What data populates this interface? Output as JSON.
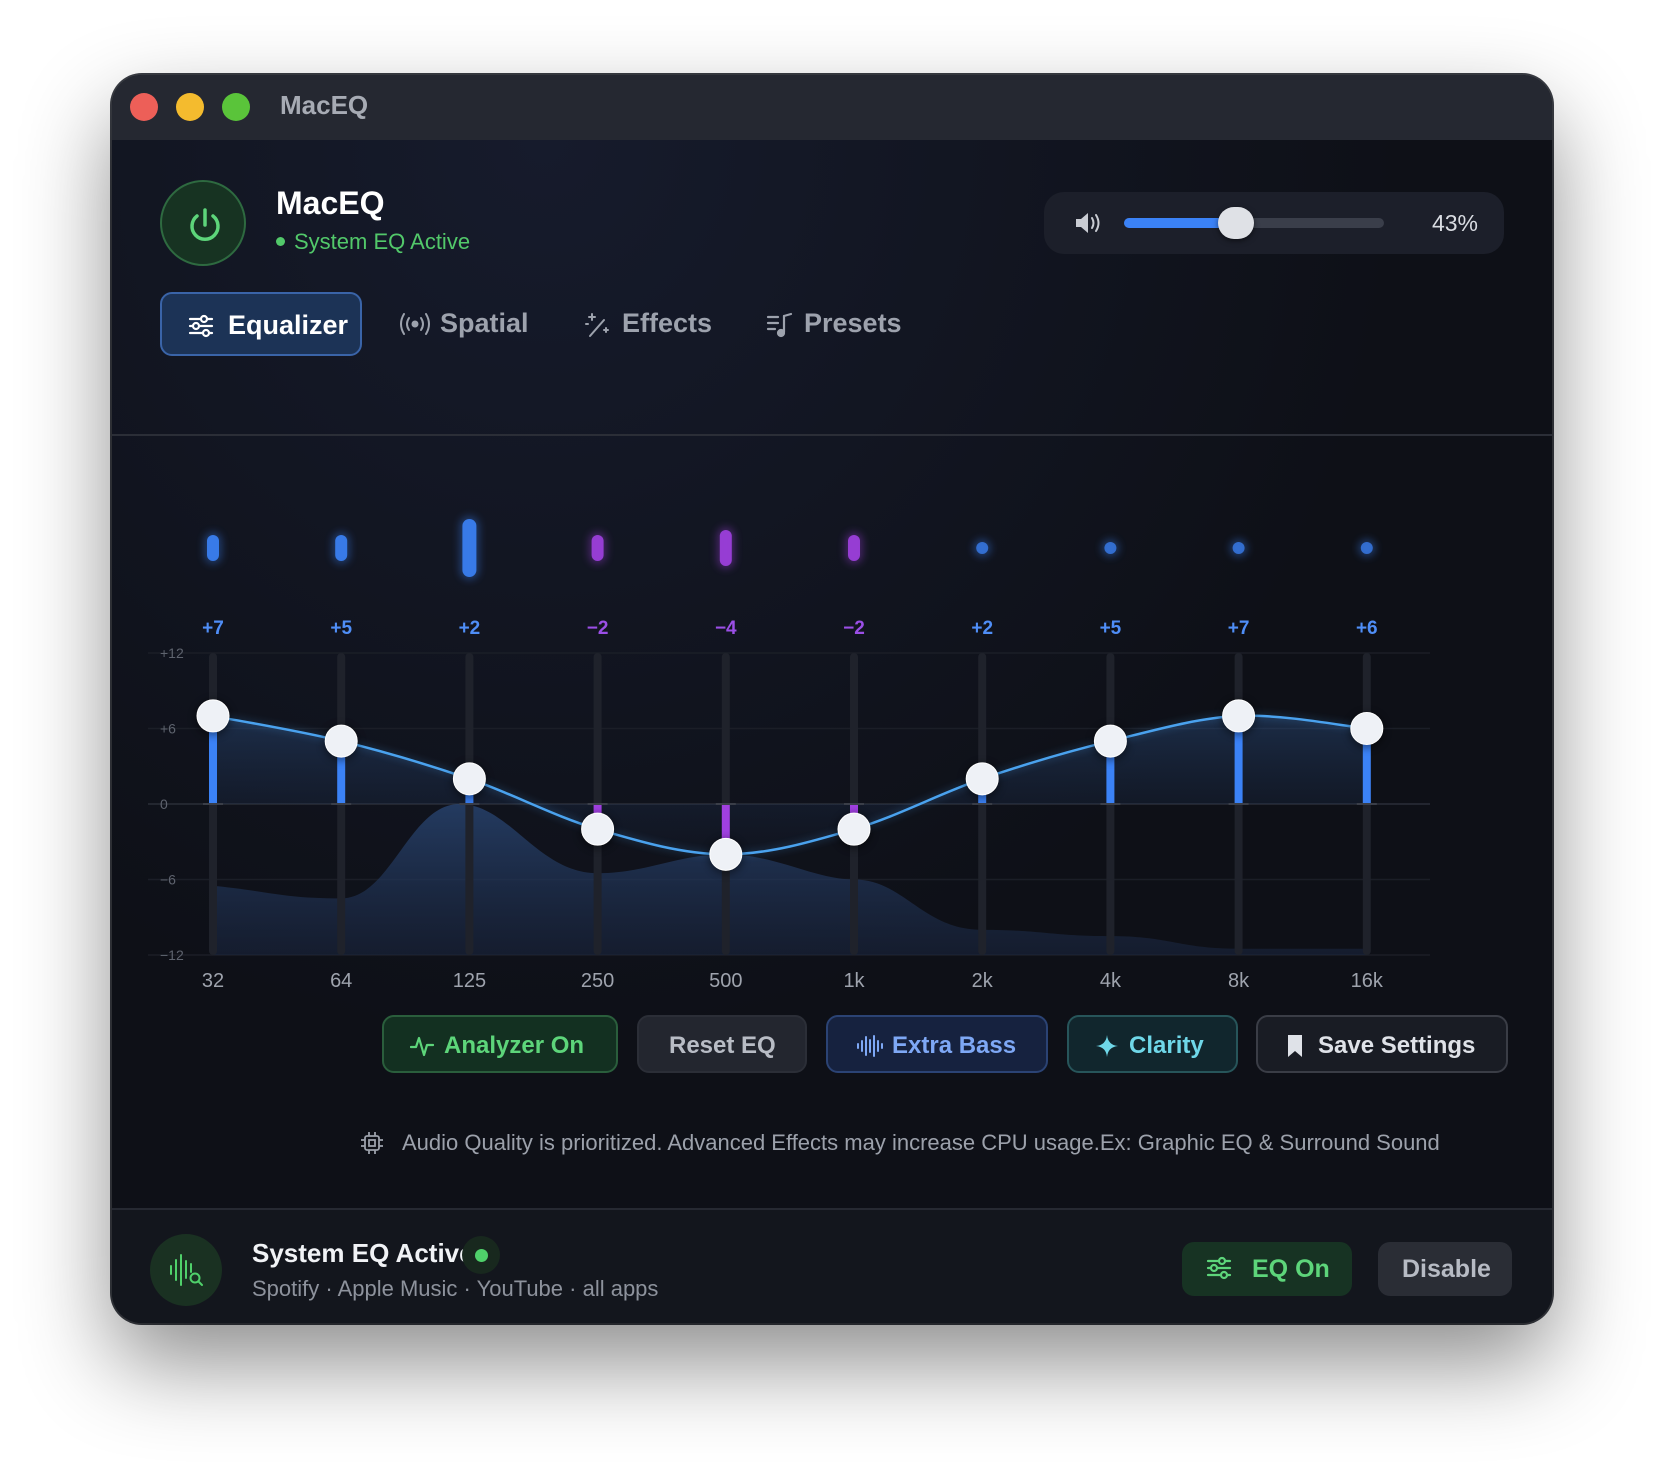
{
  "window": {
    "title": "MacEQ"
  },
  "header": {
    "app_name": "MacEQ",
    "status": "System EQ Active",
    "volume": {
      "value": 0.43,
      "label": "43%"
    }
  },
  "tabs": [
    {
      "label": "Equalizer",
      "active": true,
      "icon": "sliders-icon"
    },
    {
      "label": "Spatial",
      "active": false,
      "icon": "broadcast-icon"
    },
    {
      "label": "Effects",
      "active": false,
      "icon": "magic-wand-icon"
    },
    {
      "label": "Presets",
      "active": false,
      "icon": "music-list-icon"
    }
  ],
  "equalizer": {
    "bands": [
      {
        "freq": "32",
        "gain": 7,
        "label": "+7"
      },
      {
        "freq": "64",
        "gain": 5,
        "label": "+5"
      },
      {
        "freq": "125",
        "gain": 2,
        "label": "+2"
      },
      {
        "freq": "250",
        "gain": -2,
        "label": "−2"
      },
      {
        "freq": "500",
        "gain": -4,
        "label": "−4"
      },
      {
        "freq": "1k",
        "gain": -2,
        "label": "−2"
      },
      {
        "freq": "2k",
        "gain": 2,
        "label": "+2"
      },
      {
        "freq": "4k",
        "gain": 5,
        "label": "+5"
      },
      {
        "freq": "8k",
        "gain": 7,
        "label": "+7"
      },
      {
        "freq": "16k",
        "gain": 6,
        "label": "+6"
      }
    ],
    "y_ticks": [
      {
        "value": 12,
        "label": "+12"
      },
      {
        "value": 6,
        "label": "+6"
      },
      {
        "value": 0,
        "label": "0"
      },
      {
        "value": -6,
        "label": "−6"
      },
      {
        "value": -12,
        "label": "−12"
      }
    ],
    "ylim": [
      -12,
      12
    ],
    "analyzer_levels": [
      -6.5,
      -7.5,
      0,
      -5.5,
      -4,
      -6,
      -10,
      -10.5,
      -11.5,
      -11.5
    ],
    "colors": {
      "boost": "#3b82f6",
      "cut": "#a040e0",
      "curve": "#4aa2ee",
      "positive_label": "#4f8ef7",
      "negative_label": "#9b4fe6"
    }
  },
  "actions": {
    "analyzer": "Analyzer On",
    "reset": "Reset EQ",
    "extra_bass": "Extra Bass",
    "clarity": "Clarity",
    "save": "Save Settings"
  },
  "note": "Audio Quality is prioritized. Advanced Effects may increase CPU usage.Ex: Graphic EQ & Surround Sound",
  "footer": {
    "title": "System EQ Active",
    "subtitle": "Spotify · Apple Music · YouTube · all apps",
    "eq_on": "EQ On",
    "disable": "Disable"
  }
}
